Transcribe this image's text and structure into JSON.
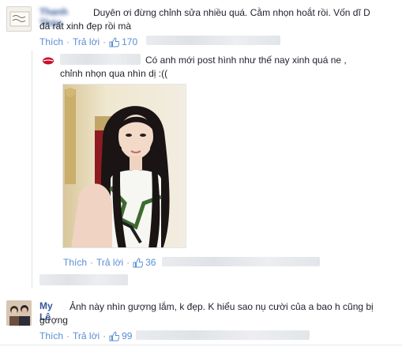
{
  "comments": [
    {
      "author": "Thanh Thảo",
      "text_line1": "Duyên ơi đừng chỉnh sửa nhiều quá. Cằm nhọn hoắt rồi. Vốn dĩ D",
      "text_line2": "đã rất xinh đẹp rồi mà",
      "like_label": "Thích",
      "reply_label": "Trả lời",
      "like_count": "170"
    },
    {
      "text_line1": "Có anh mới post hình như thế nay xinh quá ne ,",
      "text_line2": "chỉnh nhọn qua nhìn dị :((",
      "like_label": "Thích",
      "reply_label": "Trả lời",
      "like_count": "36"
    },
    {
      "author": "My Lê",
      "text_line1": "Ảnh này nhìn gượng lắm, k đẹp. K hiểu sao nụ cười của a bao h cũng bị",
      "text_line2": "gượng",
      "like_label": "Thích",
      "reply_label": "Trả lời",
      "like_count": "99"
    }
  ],
  "colors": {
    "link": "#598dd3",
    "name": "#365899",
    "meta": "#90949c"
  }
}
